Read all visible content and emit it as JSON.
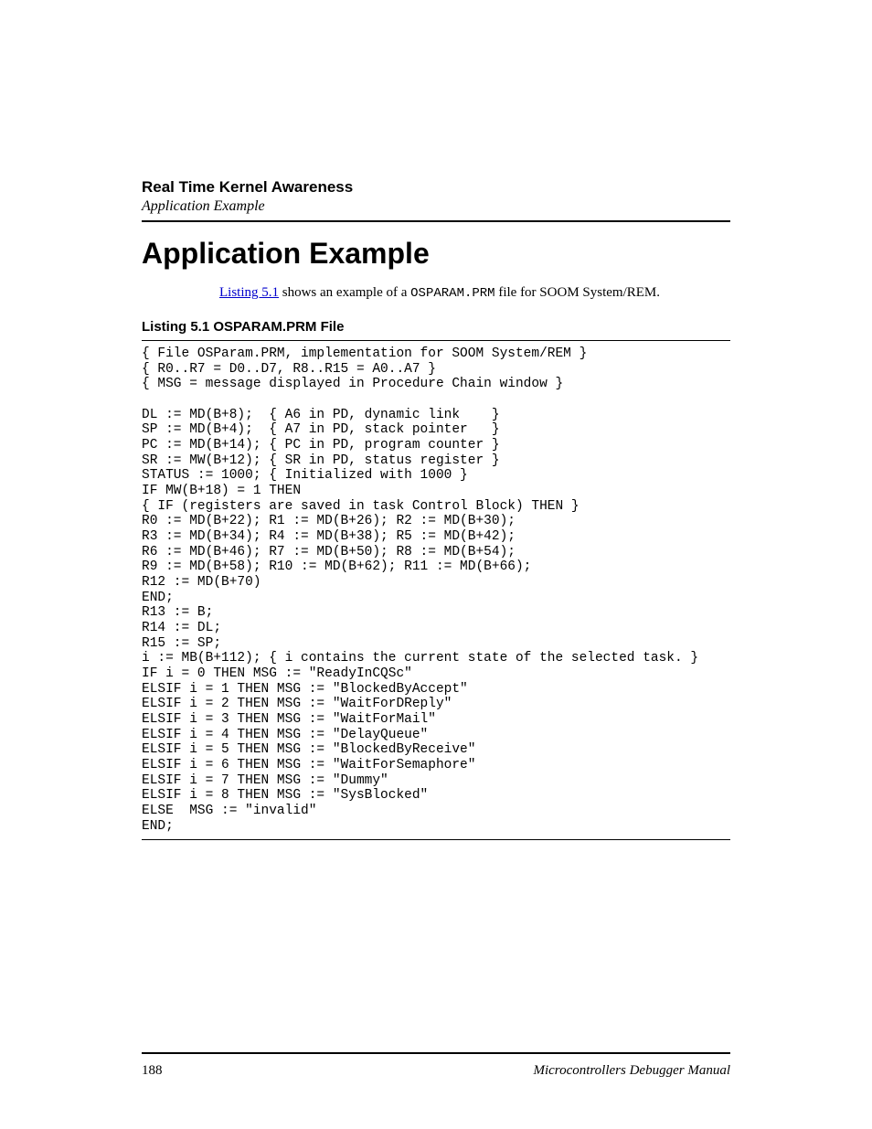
{
  "header": {
    "chapter": "Real Time Kernel Awareness",
    "section": "Application Example"
  },
  "title": "Application Example",
  "intro": {
    "link_text": "Listing 5.1",
    "pre_link": "",
    "post_link_1": " shows an example of a ",
    "code_filename": "OSPARAM.PRM",
    "post_link_2": " file for SOOM System/REM."
  },
  "listing": {
    "caption": "Listing 5.1  OSPARAM.PRM File",
    "code": "{ File OSParam.PRM, implementation for SOOM System/REM }\n{ R0..R7 = D0..D7, R8..R15 = A0..A7 }\n{ MSG = message displayed in Procedure Chain window }\n\nDL := MD(B+8);  { A6 in PD, dynamic link    }\nSP := MD(B+4);  { A7 in PD, stack pointer   }\nPC := MD(B+14); { PC in PD, program counter }\nSR := MW(B+12); { SR in PD, status register }\nSTATUS := 1000; { Initialized with 1000 }\nIF MW(B+18) = 1 THEN\n{ IF (registers are saved in task Control Block) THEN }\nR0 := MD(B+22); R1 := MD(B+26); R2 := MD(B+30);\nR3 := MD(B+34); R4 := MD(B+38); R5 := MD(B+42);\nR6 := MD(B+46); R7 := MD(B+50); R8 := MD(B+54);\nR9 := MD(B+58); R10 := MD(B+62); R11 := MD(B+66);\nR12 := MD(B+70)\nEND;\nR13 := B;\nR14 := DL;\nR15 := SP;\ni := MB(B+112); { i contains the current state of the selected task. }\nIF i = 0 THEN MSG := \"ReadyInCQSc\"\nELSIF i = 1 THEN MSG := \"BlockedByAccept\"\nELSIF i = 2 THEN MSG := \"WaitForDReply\"\nELSIF i = 3 THEN MSG := \"WaitForMail\"\nELSIF i = 4 THEN MSG := \"DelayQueue\"\nELSIF i = 5 THEN MSG := \"BlockedByReceive\"\nELSIF i = 6 THEN MSG := \"WaitForSemaphore\"\nELSIF i = 7 THEN MSG := \"Dummy\"\nELSIF i = 8 THEN MSG := \"SysBlocked\"\nELSE  MSG := \"invalid\"\nEND;"
  },
  "footer": {
    "page_number": "188",
    "manual_title": "Microcontrollers Debugger Manual"
  }
}
